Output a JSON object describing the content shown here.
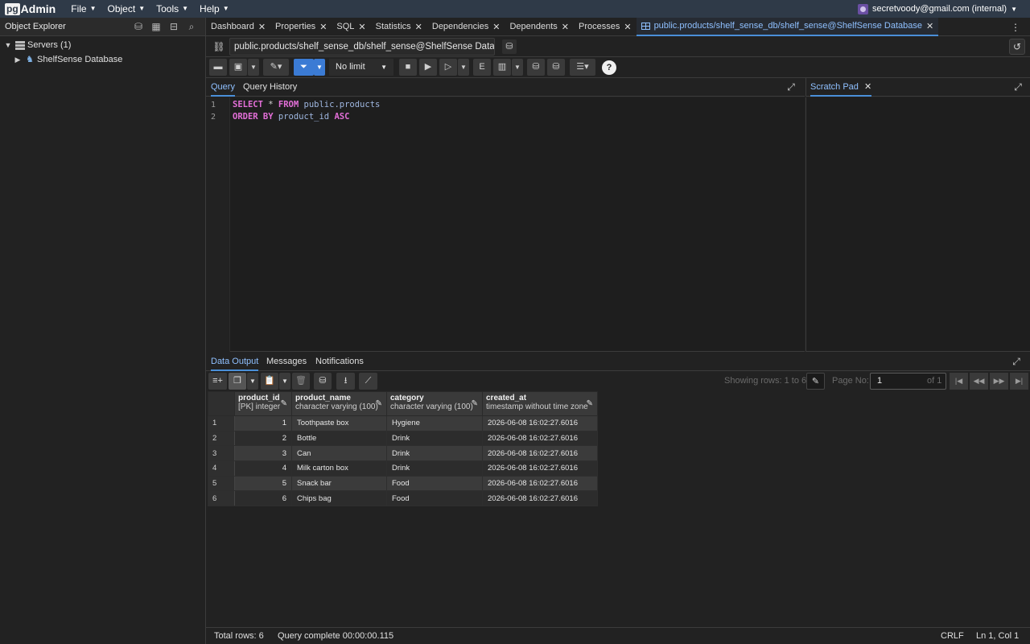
{
  "app": {
    "logo_pg": "pg",
    "logo_admin": "Admin"
  },
  "menu": {
    "file": "File",
    "object": "Object",
    "tools": "Tools",
    "help": "Help"
  },
  "user": {
    "email": "secretvoody@gmail.com (internal)"
  },
  "explorer": {
    "title": "Object Explorer",
    "servers_label": "Servers (1)",
    "database_label": "ShelfSense Database"
  },
  "tabs": {
    "dashboard": "Dashboard",
    "properties": "Properties",
    "sql": "SQL",
    "statistics": "Statistics",
    "dependencies": "Dependencies",
    "dependents": "Dependents",
    "processes": "Processes",
    "active": "public.products/shelf_sense_db/shelf_sense@ShelfSense Database"
  },
  "connection": {
    "text": "public.products/shelf_sense_db/shelf_sense@ShelfSense Data..."
  },
  "toolbar": {
    "limit": "No limit"
  },
  "editor": {
    "tab_query": "Query",
    "tab_history": "Query History",
    "scratch_pad": "Scratch Pad",
    "lines": [
      {
        "num": "1",
        "kw1": "SELECT",
        "mid": " * ",
        "kw2": "FROM",
        "ident": " public.products"
      },
      {
        "num": "2",
        "kw1": "ORDER BY",
        "ident": " product_id ",
        "kw2": "ASC"
      }
    ]
  },
  "output": {
    "tab_data": "Data Output",
    "tab_messages": "Messages",
    "tab_notifications": "Notifications",
    "showing_rows": "Showing rows: 1 to 6",
    "page_no_label": "Page No:",
    "page_no_value": "1",
    "of_pages": "of 1"
  },
  "grid": {
    "columns": [
      {
        "name": "product_id",
        "type": "[PK] integer"
      },
      {
        "name": "product_name",
        "type": "character varying (100)"
      },
      {
        "name": "category",
        "type": "character varying (100)"
      },
      {
        "name": "created_at",
        "type": "timestamp without time zone"
      }
    ],
    "rows": [
      {
        "rn": "1",
        "product_id": "1",
        "product_name": "Toothpaste box",
        "category": "Hygiene",
        "created_at": "2026-06-08 16:02:27.6016"
      },
      {
        "rn": "2",
        "product_id": "2",
        "product_name": "Bottle",
        "category": "Drink",
        "created_at": "2026-06-08 16:02:27.6016"
      },
      {
        "rn": "3",
        "product_id": "3",
        "product_name": "Can",
        "category": "Drink",
        "created_at": "2026-06-08 16:02:27.6016"
      },
      {
        "rn": "4",
        "product_id": "4",
        "product_name": "Milk carton box",
        "category": "Drink",
        "created_at": "2026-06-08 16:02:27.6016"
      },
      {
        "rn": "5",
        "product_id": "5",
        "product_name": "Snack bar",
        "category": "Food",
        "created_at": "2026-06-08 16:02:27.6016"
      },
      {
        "rn": "6",
        "product_id": "6",
        "product_name": "Chips bag",
        "category": "Food",
        "created_at": "2026-06-08 16:02:27.6016"
      }
    ]
  },
  "status": {
    "total_rows": "Total rows: 6",
    "query_complete": "Query complete 00:00:00.115",
    "line_ending": "CRLF",
    "cursor": "Ln 1, Col 1"
  },
  "colors": {
    "accent": "#4a8fd8",
    "topbar": "#2f3a48",
    "keyword": "#e36fd8"
  }
}
